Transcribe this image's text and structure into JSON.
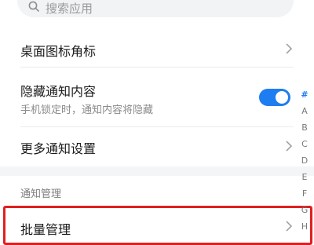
{
  "search": {
    "placeholder": "搜索应用"
  },
  "settings": [
    {
      "title": "桌面图标角标"
    },
    {
      "title": "隐藏通知内容",
      "subtitle": "手机锁定时，通知内容将隐藏",
      "toggle_on": true
    },
    {
      "title": "更多通知设置"
    }
  ],
  "section": {
    "label": "通知管理"
  },
  "batch": {
    "title": "批量管理"
  },
  "index_bar": [
    "#",
    "A",
    "B",
    "C",
    "D",
    "E",
    "F",
    "G",
    "H"
  ],
  "colors": {
    "accent": "#1e7df0",
    "highlight": "#e02020"
  }
}
